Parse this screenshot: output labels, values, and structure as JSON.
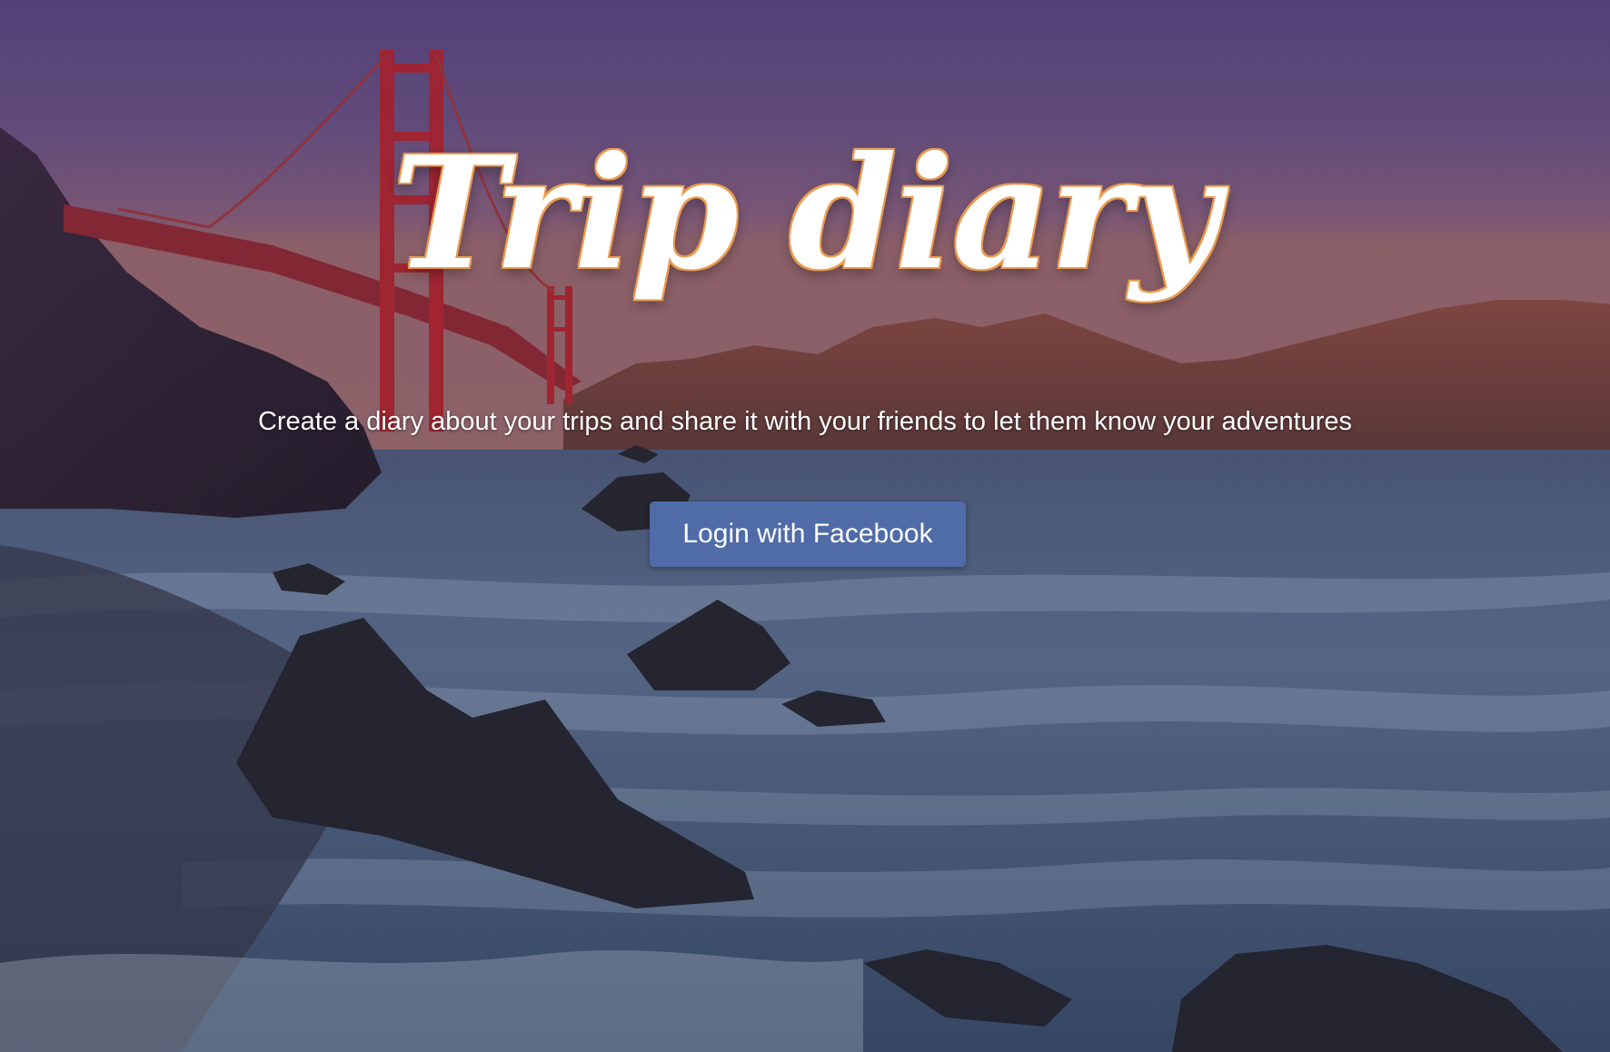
{
  "hero": {
    "title": "Trip diary",
    "subtitle": "Create a diary about your trips and share it with your friends to let them know your adventures",
    "login_label": "Login with Facebook"
  },
  "colors": {
    "button_bg": "#4f6ca8",
    "title_glow": "#e89a4e",
    "sky_top": "#5b4a86",
    "bridge": "#b3262b"
  },
  "background": {
    "scene": "golden-gate-bridge-beach-dusk"
  }
}
